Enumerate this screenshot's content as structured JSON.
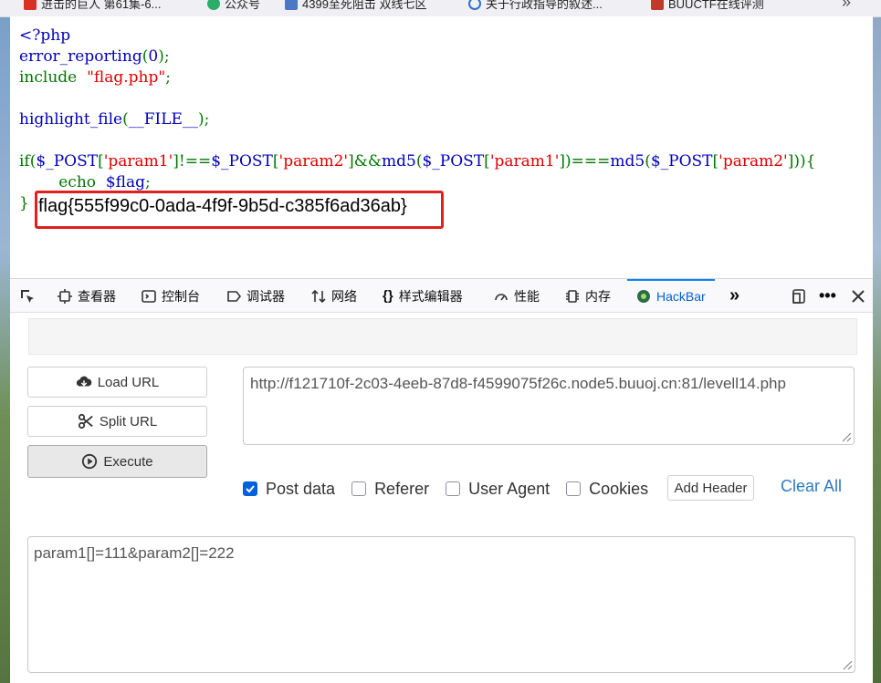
{
  "bookmarks": [
    {
      "label": "进击的巨人 第61集-6...",
      "color": "#d93025"
    },
    {
      "label": "公众号",
      "color": "#2aae67"
    },
    {
      "label": "4399至死阻击 双线七区",
      "color": "#4a78c2"
    },
    {
      "label": "关于行政指导的叙述...",
      "color": "#2b6fd6"
    },
    {
      "label": "BUUCTF在线评测",
      "color": "#c0392b"
    }
  ],
  "code": {
    "line1": "<?php",
    "line2_fn": "error_reporting",
    "line2_arg": "0",
    "line3_kw": "include",
    "line3_str": "\"flag.php\"",
    "line5_fn": "highlight_file",
    "line5_arg": "__FILE__",
    "line7_if": "if",
    "line7_post": "$_POST",
    "line7_p1": "'param1'",
    "line7_p2": "'param2'",
    "line7_md5": "md5",
    "line8_echo": "echo",
    "line8_var": "$flag",
    "line9_close": "}"
  },
  "flag_output": "flag{555f99c0-0ada-4f9f-9b5d-c385f6ad36ab}",
  "devtools": {
    "tabs": [
      "查看器",
      "控制台",
      "调试器",
      "网络",
      "样式编辑器",
      "性能",
      "内存",
      "HackBar"
    ],
    "active_tab": "HackBar"
  },
  "hackbar": {
    "load_url": "Load URL",
    "split_url": "Split URL",
    "execute": "Execute",
    "url_value": "http://f121710f-2c03-4eeb-87d8-f4599075f26c.node5.buuoj.cn:81/levell14.php",
    "options": [
      {
        "label": "Post data",
        "checked": true
      },
      {
        "label": "Referer",
        "checked": false
      },
      {
        "label": "User Agent",
        "checked": false
      },
      {
        "label": "Cookies",
        "checked": false
      }
    ],
    "add_header": "Add Header",
    "clear_all": "Clear All",
    "post_data": "param1[]=111&param2[]=222"
  }
}
